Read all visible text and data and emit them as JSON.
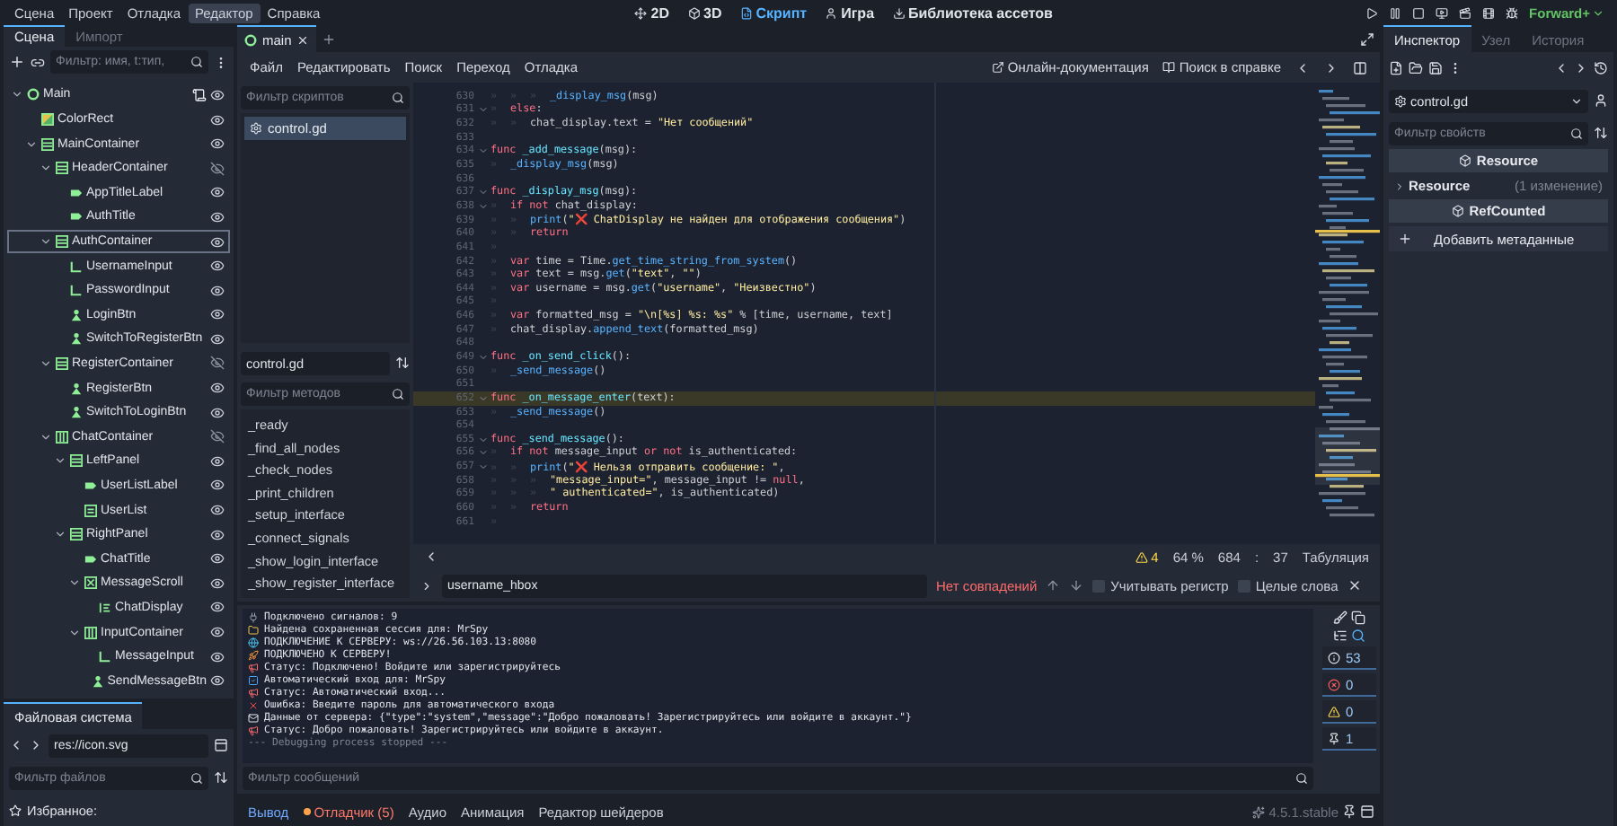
{
  "menu": [
    {
      "label": "Сцена",
      "selected": false
    },
    {
      "label": "Проект",
      "selected": false
    },
    {
      "label": "Отладка",
      "selected": false
    },
    {
      "label": "Редактор",
      "selected": true
    },
    {
      "label": "Справка",
      "selected": false
    }
  ],
  "workspaces": [
    {
      "label": "2D",
      "kind": "planar",
      "selected": false
    },
    {
      "label": "3D",
      "kind": "spatial",
      "selected": false
    },
    {
      "label": "Скрипт",
      "kind": "script",
      "selected": true
    },
    {
      "label": "Игра",
      "kind": "game",
      "selected": false
    },
    {
      "label": "Библиотека ассетов",
      "kind": "library",
      "selected": false
    }
  ],
  "renderer": "Forward+",
  "scene_dock": {
    "tabs": [
      {
        "label": "Сцена",
        "selected": true
      },
      {
        "label": "Импорт",
        "selected": false
      }
    ],
    "filter": {
      "placeholder": "Фильтр: имя, t:тип,"
    },
    "tree": [
      {
        "name": "Main",
        "kind": "root",
        "script": true,
        "visible": true,
        "selected": false,
        "expanded": true,
        "children": [
          {
            "name": "ColorRect",
            "kind": "colorrect",
            "visible": true,
            "selected": false
          },
          {
            "name": "MainContainer",
            "kind": "vbox",
            "visible": true,
            "selected": false,
            "expanded": true,
            "children": [
              {
                "name": "HeaderContainer",
                "kind": "vbox",
                "visible": false,
                "selected": false,
                "expanded": true,
                "children": [
                  {
                    "name": "AppTitleLabel",
                    "kind": "label",
                    "visible": true,
                    "selected": false
                  },
                  {
                    "name": "AuthTitle",
                    "kind": "label",
                    "visible": true,
                    "selected": false
                  }
                ]
              },
              {
                "name": "AuthContainer",
                "kind": "vbox",
                "visible": true,
                "selected": true,
                "expanded": true,
                "children": [
                  {
                    "name": "UsernameInput",
                    "kind": "lineedit",
                    "visible": true,
                    "selected": false
                  },
                  {
                    "name": "PasswordInput",
                    "kind": "lineedit",
                    "visible": true,
                    "selected": false
                  },
                  {
                    "name": "LoginBtn",
                    "kind": "button",
                    "visible": true,
                    "selected": false
                  },
                  {
                    "name": "SwitchToRegisterBtn",
                    "kind": "button",
                    "visible": true,
                    "selected": false
                  }
                ]
              },
              {
                "name": "RegisterContainer",
                "kind": "vbox",
                "visible": false,
                "selected": false,
                "expanded": true,
                "children": [
                  {
                    "name": "RegisterBtn",
                    "kind": "button",
                    "visible": true,
                    "selected": false
                  },
                  {
                    "name": "SwitchToLoginBtn",
                    "kind": "button",
                    "visible": true,
                    "selected": false
                  }
                ]
              },
              {
                "name": "ChatContainer",
                "kind": "hbox",
                "visible": false,
                "selected": false,
                "expanded": true,
                "children": [
                  {
                    "name": "LeftPanel",
                    "kind": "vbox",
                    "visible": true,
                    "selected": false,
                    "expanded": true,
                    "children": [
                      {
                        "name": "UserListLabel",
                        "kind": "label",
                        "visible": true,
                        "selected": false
                      },
                      {
                        "name": "UserList",
                        "kind": "itemlist",
                        "visible": true,
                        "selected": false
                      }
                    ]
                  },
                  {
                    "name": "RightPanel",
                    "kind": "vbox",
                    "visible": true,
                    "selected": false,
                    "expanded": true,
                    "children": [
                      {
                        "name": "ChatTitle",
                        "kind": "label",
                        "visible": true,
                        "selected": false
                      },
                      {
                        "name": "MessageScroll",
                        "kind": "scroll",
                        "visible": true,
                        "selected": false,
                        "expanded": true,
                        "children": [
                          {
                            "name": "ChatDisplay",
                            "kind": "richtext",
                            "visible": true,
                            "selected": false
                          }
                        ]
                      },
                      {
                        "name": "InputContainer",
                        "kind": "hbox",
                        "visible": true,
                        "selected": false,
                        "expanded": true,
                        "children": [
                          {
                            "name": "MessageInput",
                            "kind": "lineedit",
                            "visible": true,
                            "selected": false
                          },
                          {
                            "name": "SendMessageBtn",
                            "kind": "button",
                            "visible": true,
                            "selected": false
                          }
                        ]
                      }
                    ]
                  }
                ]
              }
            ]
          }
        ]
      }
    ]
  },
  "filesystem": {
    "tab": "Файловая система",
    "path": "res://icon.svg",
    "filter": {
      "placeholder": "Фильтр файлов"
    },
    "favorites": "Избранное:"
  },
  "script_tabs": [
    {
      "label": "main",
      "selected": true
    }
  ],
  "script_menu": [
    "Файл",
    "Редактировать",
    "Поиск",
    "Переход",
    "Отладка"
  ],
  "help_links": [
    "Онлайн-документация",
    "Поиск в справке"
  ],
  "script_list": {
    "filter": {
      "placeholder": "Фильтр скриптов"
    },
    "items": [
      {
        "label": "control.gd",
        "selected": true
      }
    ],
    "current": "control.gd",
    "method_filter": {
      "placeholder": "Фильтр методов"
    },
    "methods": [
      "_ready",
      "_find_all_nodes",
      "_check_nodes",
      "_print_children",
      "_setup_interface",
      "_connect_signals",
      "_show_login_interface",
      "_show_register_interface"
    ]
  },
  "code": {
    "lines": [
      {
        "n": "630",
        "fold": false,
        "current": false,
        "tokens": [
          {
            "kind": "tab",
            "text": "»"
          },
          {
            "kind": "tab",
            "text": "»"
          },
          {
            "kind": "tab",
            "text": "»"
          },
          {
            "kind": "call",
            "text": "_display_msg"
          },
          {
            "kind": "plain",
            "text": "(msg)"
          }
        ]
      },
      {
        "n": "631",
        "fold": true,
        "current": false,
        "tokens": [
          {
            "kind": "tab",
            "text": "»"
          },
          {
            "kind": "kw",
            "text": "else"
          },
          {
            "kind": "plain",
            "text": ":"
          }
        ]
      },
      {
        "n": "632",
        "fold": false,
        "current": false,
        "tokens": [
          {
            "kind": "tab",
            "text": "»"
          },
          {
            "kind": "tab",
            "text": "»"
          },
          {
            "kind": "plain",
            "text": "chat_display.text = "
          },
          {
            "kind": "str",
            "text": "\"Нет сообщений\""
          }
        ]
      },
      {
        "n": "633",
        "fold": false,
        "current": false
      },
      {
        "n": "634",
        "fold": true,
        "current": false,
        "tokens": [
          {
            "kind": "kw",
            "text": "func"
          },
          {
            "kind": "def",
            "text": " _add_message"
          },
          {
            "kind": "plain",
            "text": "(msg):"
          }
        ]
      },
      {
        "n": "635",
        "fold": false,
        "current": false,
        "tokens": [
          {
            "kind": "tab",
            "text": "»"
          },
          {
            "kind": "call",
            "text": "_display_msg"
          },
          {
            "kind": "plain",
            "text": "(msg)"
          }
        ]
      },
      {
        "n": "636",
        "fold": false,
        "current": false
      },
      {
        "n": "637",
        "fold": true,
        "current": false,
        "tokens": [
          {
            "kind": "kw",
            "text": "func"
          },
          {
            "kind": "def",
            "text": " _display_msg"
          },
          {
            "kind": "plain",
            "text": "(msg):"
          }
        ]
      },
      {
        "n": "638",
        "fold": true,
        "current": false,
        "tokens": [
          {
            "kind": "tab",
            "text": "»"
          },
          {
            "kind": "kw",
            "text": "if not"
          },
          {
            "kind": "plain",
            "text": " chat_display:"
          }
        ]
      },
      {
        "n": "639",
        "fold": false,
        "current": false,
        "tokens": [
          {
            "kind": "tab",
            "text": "»"
          },
          {
            "kind": "tab",
            "text": "»"
          },
          {
            "kind": "call",
            "text": "print"
          },
          {
            "kind": "plain",
            "text": "("
          },
          {
            "kind": "str",
            "text": "\"❌ ChatDisplay не найден для отображения сообщения\""
          },
          {
            "kind": "plain",
            "text": ")"
          }
        ]
      },
      {
        "n": "640",
        "fold": false,
        "current": false,
        "tokens": [
          {
            "kind": "tab",
            "text": "»"
          },
          {
            "kind": "tab",
            "text": "»"
          },
          {
            "kind": "kw",
            "text": "return"
          }
        ]
      },
      {
        "n": "641",
        "fold": false,
        "current": false,
        "tokens": [
          {
            "kind": "tab",
            "text": "»"
          }
        ]
      },
      {
        "n": "642",
        "fold": false,
        "current": false,
        "tokens": [
          {
            "kind": "tab",
            "text": "»"
          },
          {
            "kind": "kw",
            "text": "var"
          },
          {
            "kind": "plain",
            "text": " time = Time."
          },
          {
            "kind": "call",
            "text": "get_time_string_from_system"
          },
          {
            "kind": "plain",
            "text": "()"
          }
        ]
      },
      {
        "n": "643",
        "fold": false,
        "current": false,
        "tokens": [
          {
            "kind": "tab",
            "text": "»"
          },
          {
            "kind": "kw",
            "text": "var"
          },
          {
            "kind": "plain",
            "text": " text = msg."
          },
          {
            "kind": "call",
            "text": "get"
          },
          {
            "kind": "plain",
            "text": "("
          },
          {
            "kind": "str",
            "text": "\"text\""
          },
          {
            "kind": "plain",
            "text": ", "
          },
          {
            "kind": "str",
            "text": "\"\""
          },
          {
            "kind": "plain",
            "text": ")"
          }
        ]
      },
      {
        "n": "644",
        "fold": false,
        "current": false,
        "tokens": [
          {
            "kind": "tab",
            "text": "»"
          },
          {
            "kind": "kw",
            "text": "var"
          },
          {
            "kind": "plain",
            "text": " username = msg."
          },
          {
            "kind": "call",
            "text": "get"
          },
          {
            "kind": "plain",
            "text": "("
          },
          {
            "kind": "str",
            "text": "\"username\""
          },
          {
            "kind": "plain",
            "text": ", "
          },
          {
            "kind": "str",
            "text": "\"Неизвестно\""
          },
          {
            "kind": "plain",
            "text": ")"
          }
        ]
      },
      {
        "n": "645",
        "fold": false,
        "current": false,
        "tokens": [
          {
            "kind": "tab",
            "text": "»"
          }
        ]
      },
      {
        "n": "646",
        "fold": false,
        "current": false,
        "tokens": [
          {
            "kind": "tab",
            "text": "»"
          },
          {
            "kind": "kw",
            "text": "var"
          },
          {
            "kind": "plain",
            "text": " formatted_msg = "
          },
          {
            "kind": "str",
            "text": "\"\\n[%s] %s: %s\""
          },
          {
            "kind": "plain",
            "text": " % [time, username, text]"
          }
        ]
      },
      {
        "n": "647",
        "fold": false,
        "current": false,
        "tokens": [
          {
            "kind": "tab",
            "text": "»"
          },
          {
            "kind": "plain",
            "text": "chat_display."
          },
          {
            "kind": "call",
            "text": "append_text"
          },
          {
            "kind": "plain",
            "text": "(formatted_msg)"
          }
        ]
      },
      {
        "n": "648",
        "fold": false,
        "current": false
      },
      {
        "n": "649",
        "fold": true,
        "current": false,
        "tokens": [
          {
            "kind": "kw",
            "text": "func"
          },
          {
            "kind": "def",
            "text": " _on_send_click"
          },
          {
            "kind": "plain",
            "text": "():"
          }
        ]
      },
      {
        "n": "650",
        "fold": false,
        "current": false,
        "tokens": [
          {
            "kind": "tab",
            "text": "»"
          },
          {
            "kind": "call",
            "text": "_send_message"
          },
          {
            "kind": "plain",
            "text": "()"
          }
        ]
      },
      {
        "n": "651",
        "fold": false,
        "current": false
      },
      {
        "n": "652",
        "fold": true,
        "current": true,
        "tokens": [
          {
            "kind": "kw",
            "text": "func"
          },
          {
            "kind": "def",
            "text": " _on_message_enter"
          },
          {
            "kind": "plain",
            "text": "(text):"
          }
        ]
      },
      {
        "n": "653",
        "fold": false,
        "current": false,
        "tokens": [
          {
            "kind": "tab",
            "text": "»"
          },
          {
            "kind": "call",
            "text": "_send_message"
          },
          {
            "kind": "plain",
            "text": "()"
          }
        ]
      },
      {
        "n": "654",
        "fold": false,
        "current": false
      },
      {
        "n": "655",
        "fold": true,
        "current": false,
        "tokens": [
          {
            "kind": "kw",
            "text": "func"
          },
          {
            "kind": "def",
            "text": " _send_message"
          },
          {
            "kind": "plain",
            "text": "():"
          }
        ]
      },
      {
        "n": "656",
        "fold": true,
        "current": false,
        "tokens": [
          {
            "kind": "tab",
            "text": "»"
          },
          {
            "kind": "kw",
            "text": "if not"
          },
          {
            "kind": "plain",
            "text": " message_input "
          },
          {
            "kind": "kw",
            "text": "or not"
          },
          {
            "kind": "plain",
            "text": " is_authenticated:"
          }
        ]
      },
      {
        "n": "657",
        "fold": true,
        "current": false,
        "tokens": [
          {
            "kind": "tab",
            "text": "»"
          },
          {
            "kind": "tab",
            "text": "»"
          },
          {
            "kind": "call",
            "text": "print"
          },
          {
            "kind": "plain",
            "text": "("
          },
          {
            "kind": "str",
            "text": "\"❌ Нельзя отправить сообщение: \""
          },
          {
            "kind": "plain",
            "text": ","
          }
        ]
      },
      {
        "n": "658",
        "fold": false,
        "current": false,
        "tokens": [
          {
            "kind": "tab",
            "text": "»"
          },
          {
            "kind": "tab",
            "text": "»"
          },
          {
            "kind": "tab",
            "text": "»"
          },
          {
            "kind": "str",
            "text": "\"message_input=\""
          },
          {
            "kind": "plain",
            "text": ", message_input != "
          },
          {
            "kind": "kw",
            "text": "null"
          },
          {
            "kind": "plain",
            "text": ","
          }
        ]
      },
      {
        "n": "659",
        "fold": false,
        "current": false,
        "tokens": [
          {
            "kind": "tab",
            "text": "»"
          },
          {
            "kind": "tab",
            "text": "»"
          },
          {
            "kind": "tab",
            "text": "»"
          },
          {
            "kind": "str",
            "text": "\" authenticated=\""
          },
          {
            "kind": "plain",
            "text": ", is_authenticated)"
          }
        ]
      },
      {
        "n": "660",
        "fold": false,
        "current": false,
        "tokens": [
          {
            "kind": "tab",
            "text": "»"
          },
          {
            "kind": "tab",
            "text": "»"
          },
          {
            "kind": "kw",
            "text": "return"
          }
        ]
      },
      {
        "n": "661",
        "fold": false,
        "current": false,
        "tokens": [
          {
            "kind": "tab",
            "text": "»"
          }
        ]
      }
    ]
  },
  "status": {
    "warnings": "4",
    "zoom": "64 %",
    "line": "684",
    "separator": ":",
    "column": "37",
    "indent": "Табуляция"
  },
  "search": {
    "value": "username_hbox",
    "result": "Нет совпадений",
    "options": [
      {
        "label": "Учитывать регистр",
        "checked": false
      },
      {
        "label": "Целые слова",
        "checked": false
      }
    ]
  },
  "output": {
    "messages": [
      {
        "kind": "plug",
        "text": "Подключено сигналов: 9"
      },
      {
        "kind": "folder",
        "text": "Найдена сохраненная сессия для: MrSpy"
      },
      {
        "kind": "globe",
        "text": "ПОДКЛЮЧЕНИЕ К СЕРВЕРУ: ws://26.56.103.13:8080"
      },
      {
        "kind": "rocket",
        "text": "ПОДКЛЮЧЕНО К СЕРВЕРУ!"
      },
      {
        "kind": "megaphone",
        "text": "Статус: Подключено! Войдите или зарегистрируйтесь"
      },
      {
        "kind": "check",
        "text": "Автоматический вход для: MrSpy"
      },
      {
        "kind": "megaphone",
        "text": "Статус: Автоматический вход..."
      },
      {
        "kind": "error",
        "text": "Ошибка: Введите пароль для автоматического входа"
      },
      {
        "kind": "mail",
        "text": "Данные от сервера: {\"type\":\"system\",\"message\":\"Добро пожаловать! Зарегистрируйтесь или войдите в аккаунт.\"}"
      },
      {
        "kind": "megaphone",
        "text": "Статус: Добро пожаловать! Зарегистрируйтесь или войдите в аккаунт."
      },
      {
        "kind": "stop",
        "text": "--- Debugging process stopped ---"
      }
    ],
    "filter": {
      "placeholder": "Фильтр сообщений"
    },
    "counters": [
      {
        "kind": "message",
        "count": "53"
      },
      {
        "kind": "error",
        "count": "0"
      },
      {
        "kind": "warning",
        "count": "0"
      },
      {
        "kind": "editor",
        "count": "1"
      }
    ]
  },
  "bottom_tabs": [
    {
      "label": "Вывод",
      "kind": "plain",
      "selected": true
    },
    {
      "label": "Отладчик (5)",
      "kind": "alert",
      "selected": false
    },
    {
      "label": "Аудио",
      "kind": "plain",
      "selected": false
    },
    {
      "label": "Анимация",
      "kind": "plain",
      "selected": false
    },
    {
      "label": "Редактор шейдеров",
      "kind": "plain",
      "selected": false
    }
  ],
  "version": "4.5.1.stable",
  "inspector": {
    "tabs": [
      {
        "label": "Инспектор",
        "selected": true
      },
      {
        "label": "Узел",
        "selected": false
      },
      {
        "label": "История",
        "selected": false
      }
    ],
    "resource": "control.gd",
    "filter": {
      "placeholder": "Фильтр свойств"
    },
    "sections": [
      {
        "kind": "header",
        "label": "Resource"
      },
      {
        "kind": "group",
        "label": "Resource",
        "note": "(1 изменение)"
      },
      {
        "kind": "header",
        "label": "RefCounted"
      }
    ],
    "add_button": "Добавить метаданные"
  }
}
